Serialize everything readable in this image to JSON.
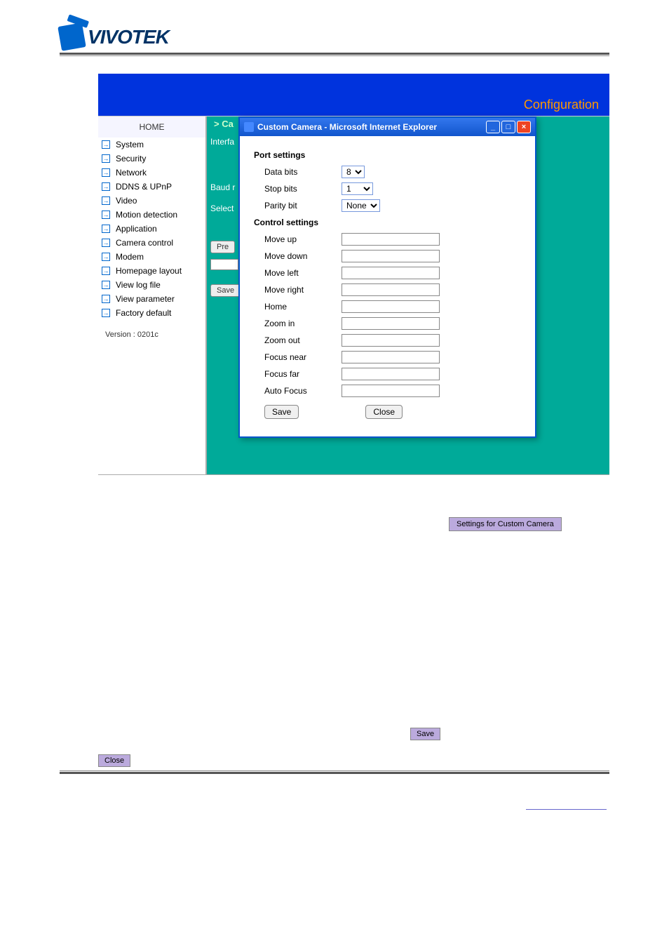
{
  "logo": {
    "text": "VIVOTEK"
  },
  "config": {
    "title": "Configuration"
  },
  "sidebar": {
    "home": "HOME",
    "items": [
      {
        "label": "System"
      },
      {
        "label": "Security"
      },
      {
        "label": "Network"
      },
      {
        "label": "DDNS & UPnP"
      },
      {
        "label": "Video"
      },
      {
        "label": "Motion detection"
      },
      {
        "label": "Application"
      },
      {
        "label": "Camera control"
      },
      {
        "label": "Modem"
      },
      {
        "label": "Homepage layout"
      },
      {
        "label": "View log file"
      },
      {
        "label": "View parameter"
      },
      {
        "label": "Factory default"
      }
    ],
    "version": "Version : 0201c"
  },
  "content": {
    "header": "> Ca",
    "interface_label": "Interfa",
    "baud_label": "Baud r",
    "select_label": "Select",
    "pr_button": "Pre",
    "save_button": "Save"
  },
  "popup": {
    "title": "Custom Camera - Microsoft Internet Explorer",
    "port_settings": "Port settings",
    "data_bits_label": "Data bits",
    "data_bits_value": "8",
    "stop_bits_label": "Stop bits",
    "stop_bits_value": "1",
    "parity_bit_label": "Parity bit",
    "parity_bit_value": "None",
    "control_settings": "Control settings",
    "controls": [
      {
        "label": "Move up"
      },
      {
        "label": "Move down"
      },
      {
        "label": "Move left"
      },
      {
        "label": "Move right"
      },
      {
        "label": "Home"
      },
      {
        "label": "Zoom in"
      },
      {
        "label": "Zoom out"
      },
      {
        "label": "Focus near"
      },
      {
        "label": "Focus far"
      },
      {
        "label": "Auto Focus"
      }
    ],
    "save_btn": "Save",
    "close_btn": "Close"
  },
  "badges": {
    "settings": "Settings for Custom Camera",
    "save": "Save",
    "close": "Close"
  }
}
